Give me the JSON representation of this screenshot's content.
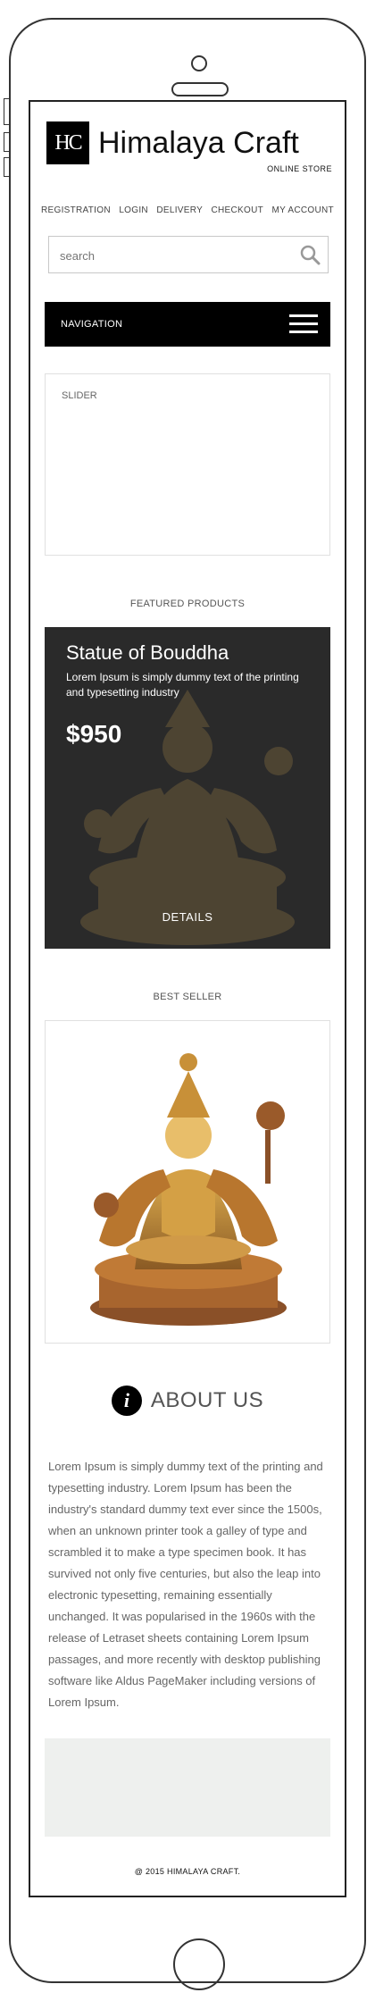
{
  "header": {
    "logo_mark": "HC",
    "brand": "Himalaya Craft",
    "tagline": "ONLINE STORE"
  },
  "topnav": {
    "items": [
      "REGISTRATION",
      "LOGIN",
      "DELIVERY",
      "CHECKOUT",
      "MY ACCOUNT"
    ]
  },
  "search": {
    "placeholder": "search",
    "icon": "search-icon"
  },
  "navigation": {
    "label": "NAVIGATION",
    "icon": "hamburger-icon"
  },
  "slider": {
    "label": "SLIDER"
  },
  "featured": {
    "section_title": "FEATURED PRODUCTS",
    "product_title": "Statue of Bouddha",
    "description": "Lorem Ipsum is simply dummy text of the printing and typesetting industry",
    "price": "$950",
    "details_label": "DETAILS"
  },
  "best_seller": {
    "section_title": "BEST SELLER"
  },
  "about": {
    "icon": "info-icon",
    "icon_glyph": "i",
    "title": "ABOUT US",
    "text": "Lorem Ipsum is simply dummy text of the printing and typesetting industry. Lorem Ipsum has been the industry's standard dummy text ever since the 1500s, when an unknown printer took a galley of type and scrambled it to make a type specimen book. It has survived not only five centuries, but also the leap into electronic typesetting, remaining essentially unchanged. It was popularised in the 1960s with the release of Letraset sheets containing Lorem Ipsum passages, and more recently with desktop publishing software like Aldus PageMaker including versions of Lorem Ipsum."
  },
  "footer": {
    "copyright": "@ 2015 HIMALAYA CRAFT."
  },
  "colors": {
    "navbar": "#000000",
    "featured_bg": "#2a2a2a",
    "footer_box": "#eef0ee",
    "gold": "#b8862e"
  }
}
